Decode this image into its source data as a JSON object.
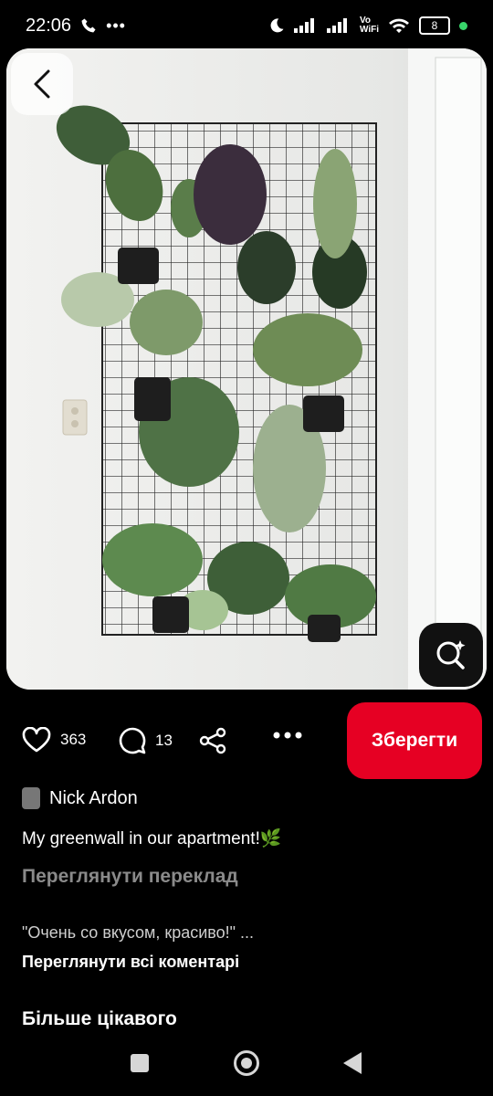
{
  "status_bar": {
    "time": "22:06",
    "battery": "8",
    "network_label": "Vo\nWiFi",
    "icons": [
      "phone-icon",
      "more-dots-icon",
      "moon-icon",
      "signal-icon",
      "signal-icon",
      "volte-wifi-icon",
      "wifi-icon",
      "battery-icon"
    ]
  },
  "pin": {
    "image_subject": "green wall of houseplants on a wire grid",
    "likes": "363",
    "comments": "13",
    "save_label": "Зберегти",
    "author": "Nick Ardon",
    "description": "My greenwall in our apartment!🌿",
    "translate_label": "Переглянути переклад",
    "top_comment": "\"Очень со вкусом, красиво!\" ...",
    "all_comments_label": "Переглянути всі коментарі",
    "more_label": "Більше цікавого"
  },
  "colors": {
    "accent": "#e60023",
    "background": "#000000",
    "muted_text": "#8a8a8a"
  }
}
